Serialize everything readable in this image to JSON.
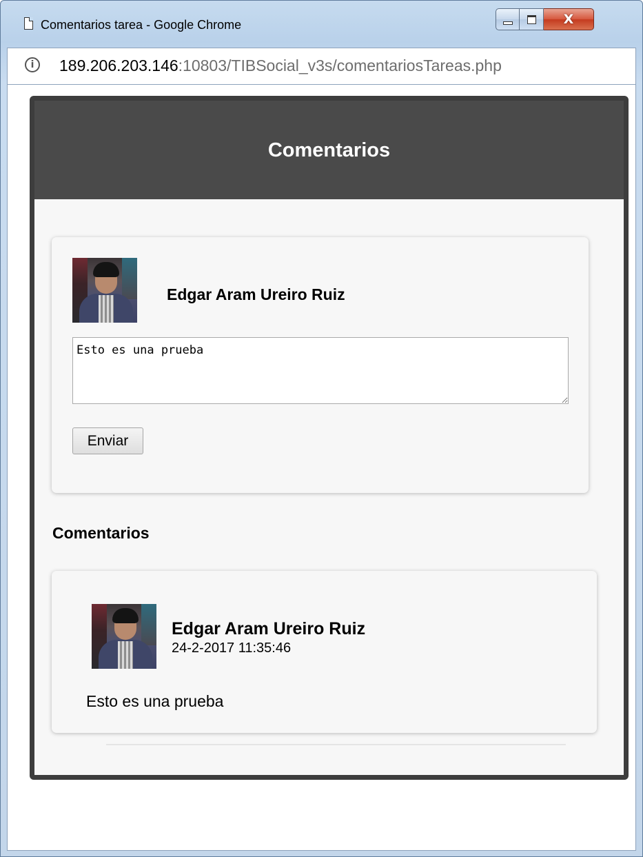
{
  "window": {
    "title": "Comentarios tarea - Google Chrome",
    "controls": {
      "minimize": "minimize",
      "maximize": "maximize",
      "close": "X"
    }
  },
  "address_bar": {
    "host": "189.206.203.146",
    "rest": ":10803/TIBSocial_v3s/comentariosTareas.php"
  },
  "modal": {
    "title": "Comentarios",
    "compose": {
      "user_name": "Edgar Aram Ureiro Ruiz",
      "input_value": "Esto es una prueba",
      "send_label": "Enviar"
    },
    "comments_title": "Comentarios",
    "comments": [
      {
        "user_name": "Edgar Aram Ureiro Ruiz",
        "date": "24-2-2017 11:35:46",
        "text": "Esto es una prueba"
      }
    ]
  },
  "colors": {
    "modal_header": "#4a4a4a",
    "modal_border": "#3d3d3d",
    "modal_background": "#f7f7f7",
    "url_rest": "#6d6d6d"
  }
}
